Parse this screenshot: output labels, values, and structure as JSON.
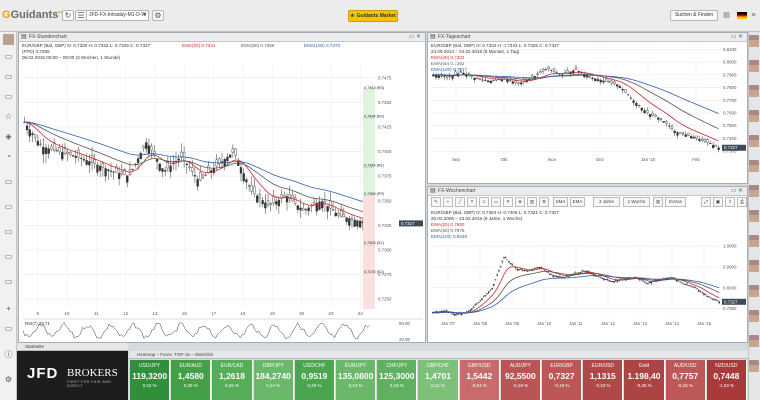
{
  "app": {
    "brand_a": "Guid",
    "brand_b": "ants",
    "badge": "PRO"
  },
  "toolbar": {
    "workspace": "JFD-FX-Intraday-M1-D-W",
    "market_button": "Guidants Market",
    "search_button": "Suchen & Finden"
  },
  "panel_hourly": {
    "title": "FX-Stundenchart",
    "quote": "EUR/GBP (Bid, GBP)  O: 0.7330  H: 0.7332  L: 0.7325  C: 0.7327",
    "ma20": "EMA(20)  0.7341",
    "ma50": "EMA(50)  0.7356",
    "ma100": "EMA(100)  0.7370",
    "line2": "(FPD)  0.7355",
    "range": "06.02.2015 00:00 – 09:00 (3 Wochen, 1 Stunde)",
    "yticks": [
      "0.7475",
      "0.7450",
      "0.7425",
      "0.7400",
      "0.7375",
      "0.7350",
      "0.7325",
      "0.7300",
      "0.7275",
      "0.7250"
    ],
    "xticks": [
      "9",
      "10",
      "11",
      "12",
      "13",
      "16",
      "17",
      "18",
      "19",
      "20",
      "23",
      "24"
    ],
    "last_price": "0.7327",
    "fib": [
      {
        "label": "0.7463 (R3)",
        "price": 0.7463
      },
      {
        "label": "0.7434 (R2)",
        "price": 0.7434
      },
      {
        "label": "0.7384 (R1)",
        "price": 0.7384
      },
      {
        "label": "0.7355 (PP)",
        "price": 0.7355
      },
      {
        "label": "0.7305 (S1)",
        "price": 0.7305
      },
      {
        "label": "0.7276 (S2)",
        "price": 0.7276
      }
    ],
    "rsi_label": "RSI(7)  28.71",
    "rsi_ticks": [
      "80.00",
      "20.00"
    ]
  },
  "panel_daily": {
    "title": "FX-Tageschart",
    "quote": "EUR/GBP (Bid, GBP)  O: 0.7334  H: 0.7343  L: 0.7325  C: 0.7327",
    "range": "24.09.2014 – 24.02.2015 (5 Monate, 1 Tag)",
    "ma20": "EMA(20)  0.7322",
    "ma50": "EMA(50)  0.7382",
    "ma100": "EMA(100)  0.7677",
    "yticks": [
      "0.8100",
      "0.8000",
      "0.7900",
      "0.7800",
      "0.7700",
      "0.7600",
      "0.7500",
      "0.7400",
      "0.7300"
    ],
    "xticks": [
      "Sep",
      "Okt",
      "Nov",
      "Dez",
      "Jan '15",
      "Feb"
    ],
    "last_price": "0.7327"
  },
  "panel_weekly": {
    "title": "FX-Wochenchart",
    "toolbar": [
      "SMA",
      "EMA",
      "3 Jahre",
      "1 Woche",
      "Extras"
    ],
    "quote": "EUR/GBP (Bid, GBP)  O: 0.7384  H: 0.7405  L: 0.7321  C: 0.7327",
    "range": "20.02.2006 – 23.02.2015 (9 Jahre, 1 Woche)",
    "ma20": "EMA(20)  0.7660",
    "ma50": "EMA(50)  0.7975",
    "ma100": "EMA(100)  0.8049",
    "yticks": [
      "1.0000",
      "0.9000",
      "0.8000",
      "0.7000"
    ],
    "xticks": [
      "Jan '07",
      "Jan '08",
      "Jan '09",
      "Jan '10",
      "Jan '11",
      "Jan '12",
      "Jan '13",
      "Jan '14",
      "Jan '15"
    ],
    "last_price": "0.7327"
  },
  "broker": {
    "head": "Startseite",
    "name_a": "JFD",
    "name_b": "BROKERS",
    "tagline": "FIRST FOR FAIR AND DIRECT"
  },
  "heatmap": {
    "title": "Heatmap – Forex: TOP-15 – Watchlist",
    "tiles": [
      {
        "name": "USD/JPY",
        "price": "119,3200",
        "change": "0,02 %",
        "color": "#2f8f3a"
      },
      {
        "name": "EUR/AUD",
        "price": "1,4580",
        "change": "0,39 %",
        "color": "#43a047"
      },
      {
        "name": "EUR/CAD",
        "price": "1,2618",
        "change": "0,26 %",
        "color": "#55ad59"
      },
      {
        "name": "GBP/JPY",
        "price": "184,2740",
        "change": "0,14 %",
        "color": "#6ab86a"
      },
      {
        "name": "USD/CHF",
        "price": "0,9519",
        "change": "0,35 %",
        "color": "#4ba54f"
      },
      {
        "name": "EUR/JPY",
        "price": "135,0800",
        "change": "0,12 %",
        "color": "#6bb86b"
      },
      {
        "name": "CHF/JPY",
        "price": "125,3000",
        "change": "0,18 %",
        "color": "#5fb161"
      },
      {
        "name": "GBP/CHF",
        "price": "1,4701",
        "change": "0,11 %",
        "color": "#7cc07a"
      },
      {
        "name": "GBP/USD",
        "price": "1,5442",
        "change": "-0,04 %",
        "color": "#c86b6b"
      },
      {
        "name": "AUD/JPY",
        "price": "92,5500",
        "change": "-0,19 %",
        "color": "#b95555"
      },
      {
        "name": "EUR/GBP",
        "price": "0,7327",
        "change": "-0,18 %",
        "color": "#bb5757"
      },
      {
        "name": "EUR/USD",
        "price": "1,1315",
        "change": "-0,23 %",
        "color": "#b04848"
      },
      {
        "name": "Gold",
        "price": "1.198,40",
        "change": "-0,26 %",
        "color": "#ad4444"
      },
      {
        "name": "AUD/USD",
        "price": "0,7757",
        "change": "-0,18 %",
        "color": "#bc5858"
      },
      {
        "name": "NZD/USD",
        "price": "0,7448",
        "change": "-1,03 %",
        "color": "#a83a3a"
      }
    ]
  },
  "colors": {
    "candle_up": "#333333",
    "ema20": "#cc2b2b",
    "ema50": "#555555",
    "ema100": "#2f5fb3",
    "accent": "#f5c400"
  }
}
